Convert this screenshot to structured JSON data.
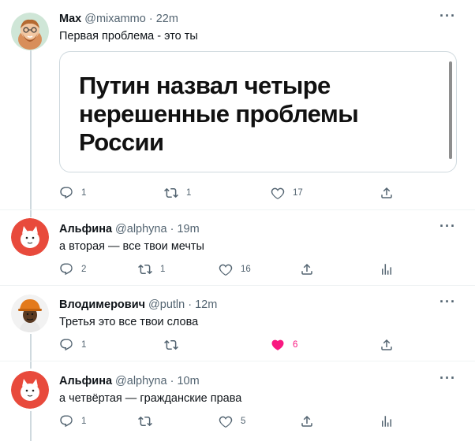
{
  "tweets": [
    {
      "name": "Max",
      "handle": "@mixammo",
      "time": "22m",
      "text": "Первая проблема - это ты",
      "card": {
        "headline": "Путин назвал четыре\nнерешенные проблемы\nРоссии"
      },
      "actions": {
        "reply": "1",
        "retweet": "1",
        "like": "17",
        "share": ""
      }
    },
    {
      "name": "Альфина",
      "handle": "@alphyna",
      "time": "19m",
      "text": "а вторая — все твои мечты",
      "actions": {
        "reply": "2",
        "retweet": "1",
        "like": "16",
        "share": ""
      }
    },
    {
      "name": "Влодимерович",
      "handle": "@putln",
      "time": "12m",
      "text": "Третья это все твои слова",
      "actions": {
        "reply": "1",
        "retweet": "",
        "like": "6",
        "share": ""
      }
    },
    {
      "name": "Альфина",
      "handle": "@alphyna",
      "time": "10m",
      "text": "а четвёртая — гражданские права",
      "actions": {
        "reply": "1",
        "retweet": "",
        "like": "5",
        "share": ""
      }
    }
  ],
  "ui": {
    "dot": "·",
    "more": "···"
  },
  "colors": {
    "like_active": "#f91880",
    "muted": "#536471",
    "thread_line": "#cfd9de"
  }
}
